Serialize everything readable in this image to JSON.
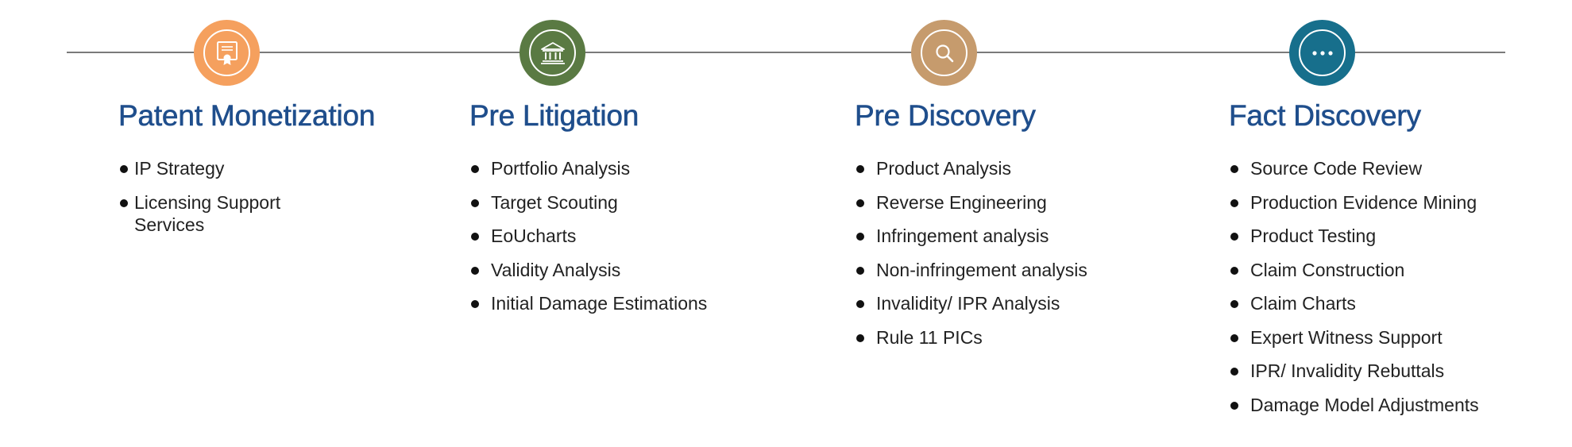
{
  "stages": [
    {
      "title": "Patent Monetization",
      "icon": "certificate-icon",
      "color": "#f5a05e",
      "items": [
        "IP Strategy",
        "Licensing Support Services"
      ]
    },
    {
      "title": "Pre Litigation",
      "icon": "bank-icon",
      "color": "#5a7a43",
      "items": [
        "Portfolio Analysis",
        "Target Scouting",
        "EoUcharts",
        "Validity Analysis",
        "Initial Damage Estimations"
      ]
    },
    {
      "title": "Pre Discovery",
      "icon": "search-icon",
      "color": "#c69b6d",
      "items": [
        "Product Analysis",
        "Reverse Engineering",
        "Infringement analysis",
        "Non-infringement analysis",
        "Invalidity/ IPR Analysis",
        "Rule 11 PICs"
      ]
    },
    {
      "title": "Fact Discovery",
      "icon": "more-icon",
      "color": "#176f8c",
      "items": [
        "Source Code Review",
        "Production Evidence Mining",
        "Product Testing",
        "Claim Construction",
        "Claim Charts",
        "Expert Witness Support",
        "IPR/ Invalidity Rebuttals",
        "Damage Model Adjustments"
      ]
    }
  ],
  "colors": {
    "title": "#1f4e8c",
    "line": "#7a7a7a",
    "text": "#222222"
  }
}
